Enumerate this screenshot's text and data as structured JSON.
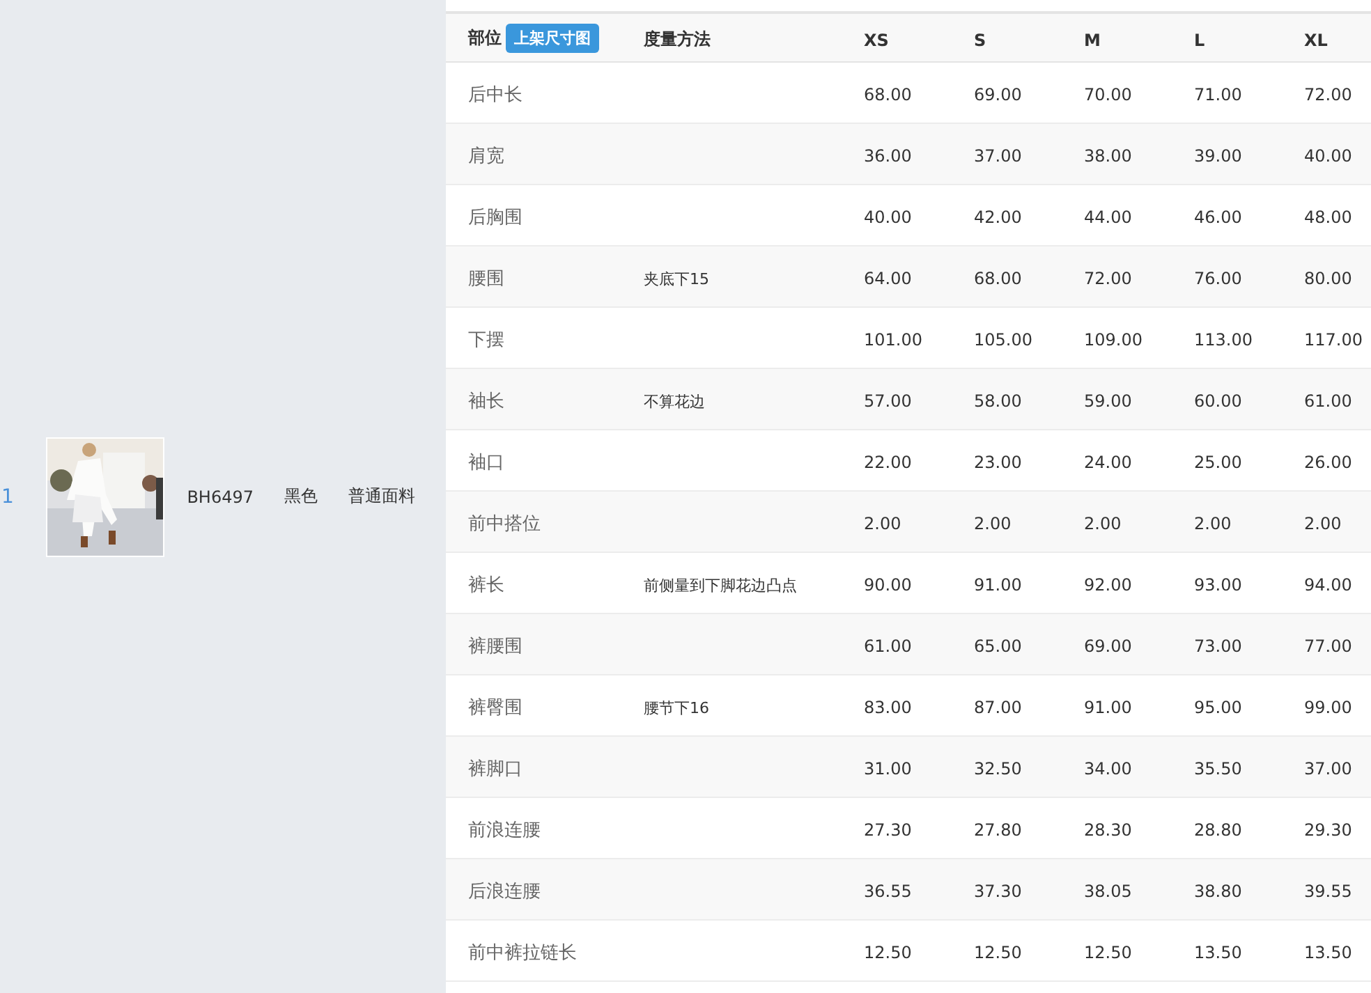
{
  "product": {
    "index": "1",
    "code": "BH6497",
    "color_label": "黑色",
    "fabric": "普通面料"
  },
  "size_table": {
    "columns": {
      "part": "部位",
      "badge": "上架尺寸图",
      "method": "度量方法",
      "sizes": [
        "XS",
        "S",
        "M",
        "L",
        "XL"
      ]
    },
    "rows": [
      {
        "part": "后中长",
        "method": "",
        "values": [
          "68.00",
          "69.00",
          "70.00",
          "71.00",
          "72.00"
        ]
      },
      {
        "part": "肩宽",
        "method": "",
        "values": [
          "36.00",
          "37.00",
          "38.00",
          "39.00",
          "40.00"
        ]
      },
      {
        "part": "后胸围",
        "method": "",
        "values": [
          "40.00",
          "42.00",
          "44.00",
          "46.00",
          "48.00"
        ]
      },
      {
        "part": "腰围",
        "method": "夹底下15",
        "values": [
          "64.00",
          "68.00",
          "72.00",
          "76.00",
          "80.00"
        ]
      },
      {
        "part": "下摆",
        "method": "",
        "values": [
          "101.00",
          "105.00",
          "109.00",
          "113.00",
          "117.00"
        ]
      },
      {
        "part": "袖长",
        "method": "不算花边",
        "values": [
          "57.00",
          "58.00",
          "59.00",
          "60.00",
          "61.00"
        ]
      },
      {
        "part": "袖口",
        "method": "",
        "values": [
          "22.00",
          "23.00",
          "24.00",
          "25.00",
          "26.00"
        ]
      },
      {
        "part": "前中搭位",
        "method": "",
        "values": [
          "2.00",
          "2.00",
          "2.00",
          "2.00",
          "2.00"
        ]
      },
      {
        "part": "裤长",
        "method": "前侧量到下脚花边凸点",
        "values": [
          "90.00",
          "91.00",
          "92.00",
          "93.00",
          "94.00"
        ]
      },
      {
        "part": "裤腰围",
        "method": "",
        "values": [
          "61.00",
          "65.00",
          "69.00",
          "73.00",
          "77.00"
        ]
      },
      {
        "part": "裤臀围",
        "method": "腰节下16",
        "values": [
          "83.00",
          "87.00",
          "91.00",
          "95.00",
          "99.00"
        ]
      },
      {
        "part": "裤脚口",
        "method": "",
        "values": [
          "31.00",
          "32.50",
          "34.00",
          "35.50",
          "37.00"
        ]
      },
      {
        "part": "前浪连腰",
        "method": "",
        "values": [
          "27.30",
          "27.80",
          "28.30",
          "28.80",
          "29.30"
        ]
      },
      {
        "part": "后浪连腰",
        "method": "",
        "values": [
          "36.55",
          "37.30",
          "38.05",
          "38.80",
          "39.55"
        ]
      },
      {
        "part": "前中裤拉链长",
        "method": "",
        "values": [
          "12.50",
          "12.50",
          "12.50",
          "13.50",
          "13.50"
        ]
      }
    ]
  }
}
